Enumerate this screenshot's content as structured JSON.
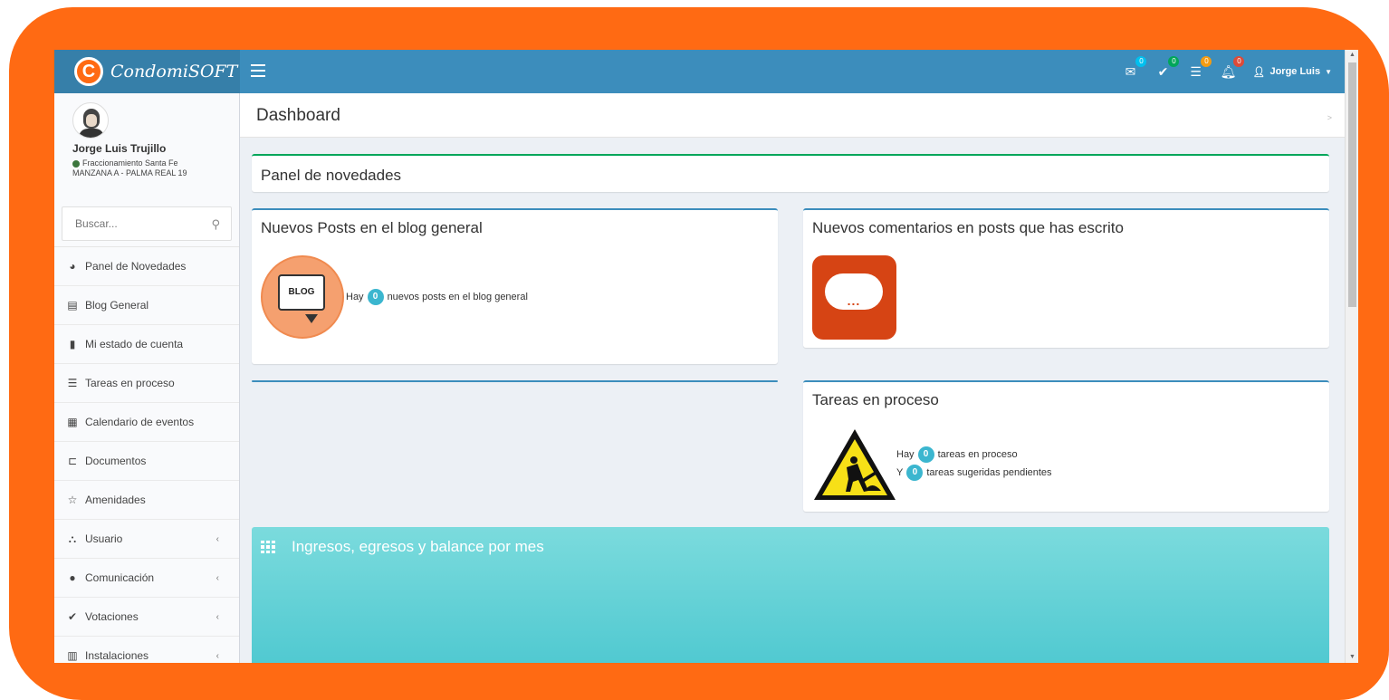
{
  "app": {
    "logo_letter": "C",
    "name": "CondomiSOFT"
  },
  "navbar": {
    "menu_toggle_icon": "hamburger-icon",
    "notifications": [
      {
        "icon": "envelope-icon",
        "count": "0",
        "color": "#00c0ef"
      },
      {
        "icon": "check-icon",
        "count": "0",
        "color": "#00a65a"
      },
      {
        "icon": "tasks-icon",
        "count": "0",
        "color": "#f39c12"
      },
      {
        "icon": "bell-icon",
        "count": "0",
        "color": "#dd4b39"
      }
    ],
    "user_label": "Jorge Luis"
  },
  "sidebar": {
    "user": {
      "name": "Jorge Luis Trujillo",
      "status_line1": "Fraccionamiento Santa Fe",
      "status_line2": "MANZANA A - PALMA REAL 19"
    },
    "search_placeholder": "Buscar...",
    "items": [
      {
        "label": "Panel de Novedades",
        "icon": "dashboard-icon"
      },
      {
        "label": "Blog General",
        "icon": "file-text-icon"
      },
      {
        "label": "Mi estado de cuenta",
        "icon": "file-icon"
      },
      {
        "label": "Tareas en proceso",
        "icon": "tasks-icon"
      },
      {
        "label": "Calendario de eventos",
        "icon": "calendar-icon"
      },
      {
        "label": "Documentos",
        "icon": "folder-open-icon"
      },
      {
        "label": "Amenidades",
        "icon": "star-icon"
      },
      {
        "label": "Usuario",
        "icon": "sitemap-icon",
        "expandable": true
      },
      {
        "label": "Comunicación",
        "icon": "comments-icon",
        "expandable": true
      },
      {
        "label": "Votaciones",
        "icon": "check-icon",
        "expandable": true
      },
      {
        "label": "Instalaciones",
        "icon": "building-icon",
        "expandable": true
      }
    ]
  },
  "content": {
    "page_title": "Dashboard",
    "breadcrumb": ">",
    "panel_novedades": {
      "title": "Panel de novedades",
      "accent": "#00a65a"
    },
    "blog_box": {
      "title": "Nuevos Posts en el blog general",
      "icon_text": "BLOG",
      "prefix": "Hay",
      "count": "0",
      "suffix": "nuevos posts en el blog general"
    },
    "comments_box": {
      "title": "Nuevos comentarios en posts que has escrito",
      "icon_text": "..."
    },
    "tasks_box": {
      "title": "Tareas en proceso",
      "line1_prefix": "Hay",
      "line1_count": "0",
      "line1_suffix": "tareas en proceso",
      "line2_prefix": "Y",
      "line2_count": "0",
      "line2_suffix": "tareas sugeridas pendientes"
    },
    "chart_box": {
      "title": "Ingresos, egresos y balance por mes",
      "icon": "th-icon"
    }
  },
  "colors": {
    "brand_orange": "#FF6A13",
    "navbar_blue": "#3c8dbc",
    "logo_blue": "#367fa9",
    "badge_teal": "#3bb6cf"
  }
}
